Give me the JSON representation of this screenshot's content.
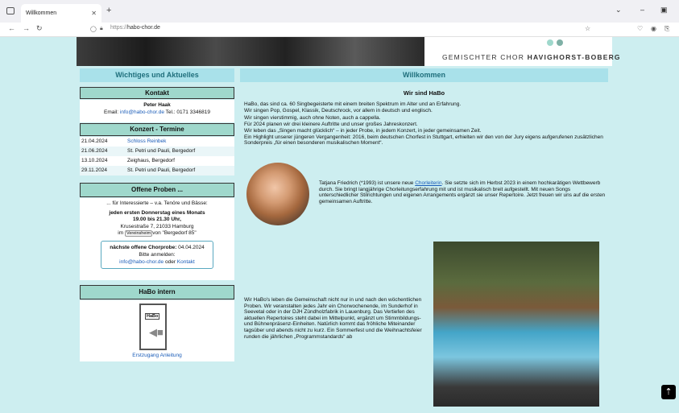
{
  "browser": {
    "tab_title": "Willkommen",
    "url_scheme": "https://",
    "url_host": "habo-chor.de"
  },
  "header": {
    "choir_name_prefix": "GEMISCHTER CHOR ",
    "choir_name_bold": "HAVIGHORST-BOBERG",
    "dot_colors": [
      "#9fd8cc",
      "#7fb0a6"
    ]
  },
  "sidebar": {
    "title": "Wichtiges und Aktuelles",
    "kontakt": {
      "heading": "Kontakt",
      "name": "Peter Haak",
      "email_label": "Email: ",
      "email": "info@habo-chor.de",
      "tel": " Tel.: 0171 3346819"
    },
    "termine": {
      "heading": "Konzert - Termine",
      "rows": [
        {
          "date": "21.04.2024",
          "place": "Schloss Reinbek",
          "link": true
        },
        {
          "date": "21.06.2024",
          "place": "St. Petri und Pauli, Bergedorf",
          "link": false
        },
        {
          "date": "13.10.2024",
          "place": "Zeighaus, Bergedorf",
          "link": false
        },
        {
          "date": "29.11.2024",
          "place": "St. Petri und Pauli, Bergedorf",
          "link": false
        }
      ]
    },
    "proben": {
      "heading": "Offene Proben ...",
      "intro": "... für Interessierte – v.a. Tenöre und Bässe:",
      "when_line1": "jeden ersten Donnerstag eines Monats",
      "when_line2": "19.00 bis 21.30 Uhr,",
      "address": "Krusestraße 7, 21033 Hamburg",
      "im": "im",
      "chip": "Vereinsheim",
      "von": "von \"Bergedorf 85\"",
      "next_label": "nächste offene Chorprobe:",
      "next_date": " 04.04.2024",
      "anmelden": "Bitte anmelden:",
      "email": "info@habo-chor.de",
      "oder": " oder ",
      "kontakt_link": "Kontakt"
    },
    "intern": {
      "heading": "HaBo intern",
      "door_sign": "HaBo",
      "link": "Erstzugang Anleitung"
    }
  },
  "main": {
    "title": "Willkommen",
    "subtitle": "Wir sind HaBo",
    "intro_lines": [
      "HaBo, das sind ca. 60 Singbegeisterte mit einem breiten Spektrum im Alter und an Erfahrung.",
      "Wir singen Pop, Gospel, Klassik, Deutschrock, vor allem in deutsch und englisch.",
      "Wir singen vierstimmig, auch ohne Noten, auch a cappella.",
      "Für 2024 planen wir drei kleinere Auftritte und unser großes Jahreskonzert.",
      "Wir leben das „Singen macht glücklich“ – in jeder Probe, in jedem Konzert, in jeder gemeinsamen Zeit.",
      "Ein Highlight unserer jüngeren Vergangenheit: 2016, beim deutschen Chorfest in Stuttgart, erhielten wir den von der Jury eigens aufgerufenen zusätzlichen Sonderpreis „für einen besonderen musikalischen Moment“."
    ],
    "leader_pre": "Tatjana Friedrich (*1993) ist unsere neue ",
    "leader_link": "Chorleiterin",
    "leader_post": ". Sie setzte sich im Herbst 2023 in einem hochkarätigen Wettbewerb durch. Sie bringt langjährige Chorleitungserfahrung mit und ist musikalisch breit aufgestellt. Mit neuen Songs unterschiedlicher Stilrichtungen und eigenen Arrangements ergänzt sie unser Repertoire. Jetzt freuen wir uns auf die ersten gemeinsamen Auftritte.",
    "community_text": "Wir HaBo's leben die Gemeinschaft nicht nur in und nach den wöchentlichen Proben. Wir veranstalten jedes Jahr ein Chorwochenende, im Sunderhof in Seevetal oder in der DJH Zündholzfabrik in Lauenburg. Das Vertiefen des aktuellen Repertoires steht dabei im Mittelpunkt, ergänzt um Stimmbildungs- und Bühnenpräsenz-Einheiten. Natürlich kommt das fröhliche Miteinander tagsüber und abends nicht zu kurz. Ein Sommerfest und die Weihnachtsfeier runden die jährlichen „Programmstandards“ ab"
  }
}
